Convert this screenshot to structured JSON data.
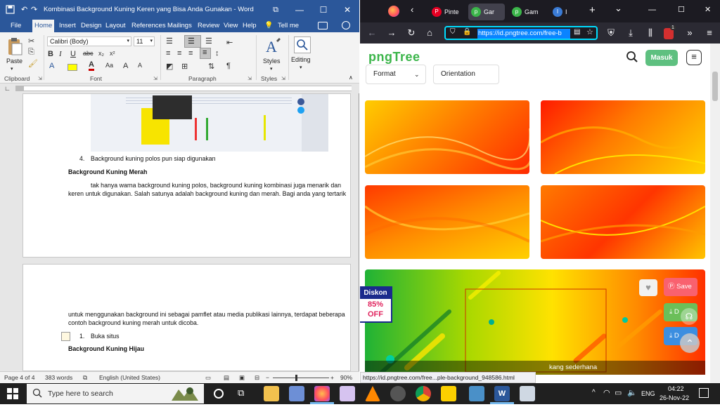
{
  "word": {
    "title": "Kombinasi Background Kuning Keren yang Bisa Anda Gunakan  -  Word",
    "win_controls": {
      "restore": "⧉",
      "minimize": "—",
      "maximize": "☐",
      "close": "✕"
    },
    "tabs": [
      "File",
      "Home",
      "Insert",
      "Design",
      "Layout",
      "References",
      "Mailings",
      "Review",
      "View",
      "Help",
      "Tell me"
    ],
    "active_tab": "Home",
    "ribbon": {
      "font_name": "Calibri (Body)",
      "font_size": "11",
      "paste": "Paste",
      "styles": "Styles",
      "editing": "Editing",
      "groups": {
        "clipboard": "Clipboard",
        "font": "Font",
        "paragraph": "Paragraph",
        "styles": "Styles"
      }
    },
    "doc": {
      "item4_num": "4.",
      "item4": "Background kuning polos pun siap digunakan",
      "heading_merah": "Background Kuning Merah",
      "para1_line1": "tak hanya warna background kuning polos, background kuning kombinasi juga menarik dan",
      "para1_line2": "keren untuk digunakan. Salah satunya adalah background kuning dan merah. Bagi anda yang tertarik",
      "para2_line1": "untuk menggunakan background ini sebagai pamflet atau media publikasi lainnya, terdapat beberapa",
      "para2_line2": "contoh background kuning merah untuk dicoba.",
      "item1_num": "1.",
      "item1": "Buka situs",
      "heading_hijau": "Background Kuning Hijau"
    },
    "status": {
      "page": "Page 4 of 4",
      "words": "383 words",
      "language": "English (United States)",
      "zoom": "90%"
    }
  },
  "firefox": {
    "tabs": [
      {
        "label": "Pinte",
        "icon": "P"
      },
      {
        "label": "Gar",
        "icon": "p"
      },
      {
        "label": "Gam",
        "icon": "p"
      },
      {
        "label": "I",
        "icon": "I"
      }
    ],
    "new_tab": "+",
    "menu_arrow": "⌄",
    "win_controls": {
      "minimize": "—",
      "maximize": "☐",
      "close": "✕"
    },
    "url": "https://id.pngtree.com/free-b",
    "extension_badge": "1",
    "site": {
      "logo": "pngTree",
      "login": "Masuk",
      "filters": [
        {
          "label": "Format"
        },
        {
          "label": "Orientation"
        }
      ],
      "card_actions": {
        "save": "Save",
        "download1": "D",
        "download2": "D"
      },
      "discount": {
        "line1": "Diskon",
        "line2": "85%",
        "line3": "OFF"
      },
      "bottom_caption": "kang sederhana"
    },
    "link_status": "https://id.pngtree.com/free...ple-background_948586.html"
  },
  "taskbar": {
    "search_placeholder": "Type here to search",
    "language": "ENG",
    "time": "04:22",
    "date": "26-Nov-22"
  },
  "colors": {
    "word_blue": "#2b579a",
    "ff_dark": "#1c1b22",
    "pngtree_green": "#5ec080",
    "taskbar": "#202020"
  }
}
